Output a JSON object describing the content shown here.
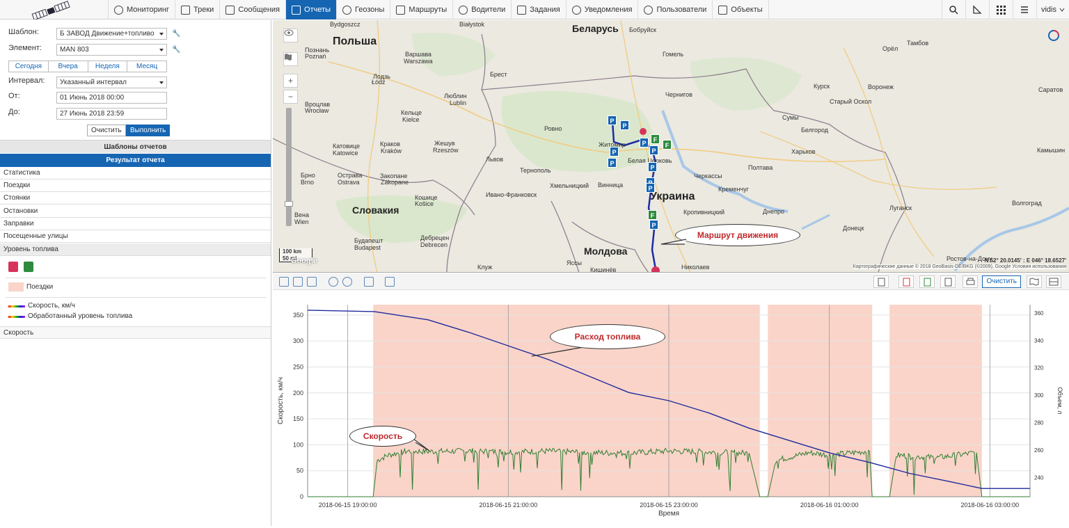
{
  "nav": {
    "items": [
      {
        "label": "Мониторинг",
        "icon": "globe-icon"
      },
      {
        "label": "Треки",
        "icon": "track-icon"
      },
      {
        "label": "Сообщения",
        "icon": "messages-icon"
      },
      {
        "label": "Отчеты",
        "icon": "reports-icon",
        "active": true
      },
      {
        "label": "Геозоны",
        "icon": "geofence-icon"
      },
      {
        "label": "Маршруты",
        "icon": "routes-icon"
      },
      {
        "label": "Водители",
        "icon": "driver-icon"
      },
      {
        "label": "Задания",
        "icon": "tasks-icon"
      },
      {
        "label": "Уведомления",
        "icon": "notifications-icon"
      },
      {
        "label": "Пользователи",
        "icon": "users-icon"
      },
      {
        "label": "Объекты",
        "icon": "truck-icon"
      }
    ],
    "user": "vidis"
  },
  "form": {
    "template_label": "Шаблон:",
    "template_value": "Б    ЗАВОД Движение+топливо",
    "element_label": "Элемент:",
    "element_value": "MAN 803",
    "quick": [
      "Сегодня",
      "Вчера",
      "Неделя",
      "Месяц"
    ],
    "interval_label": "Интервал:",
    "interval_value": "Указанный интервал",
    "from_label": "От:",
    "from_value": "01 Июнь 2018 00:00",
    "to_label": "До:",
    "to_value": "27 Июнь 2018 23:59",
    "clear": "Очистить",
    "run": "Выполнить"
  },
  "panels": {
    "templates_header": "Шаблоны отчетов",
    "result_header": "Результат отчета",
    "items": [
      "Статистика",
      "Поездки",
      "Стоянки",
      "Остановки",
      "Заправки",
      "Посещенные улицы",
      "Уровень топлива"
    ],
    "legend_trips": "Поездки",
    "legend_speed": "Скорость, км/ч",
    "legend_fuel": "Обработанный уровень топлива",
    "speed_item": "Скорость"
  },
  "map": {
    "countries": [
      {
        "label": "Польша"
      },
      {
        "label": "Беларусь"
      },
      {
        "label": "Украина"
      },
      {
        "label": "Словакия"
      },
      {
        "label": "Молдова"
      }
    ],
    "cities": [
      "Bydgoszcz",
      "Białystok",
      "Бобруйск",
      "Тамбов",
      "Познань",
      "Poznań",
      "Варшава",
      "Warszawa",
      "Гомель",
      "Орёл",
      "Брест",
      "Лодзь",
      "Łódź",
      "Люблин",
      "Lublin",
      "Чернигов",
      "Курск",
      "Воронеж",
      "Саратов",
      "Вроцлав",
      "Wrocław",
      "Кельце",
      "Kielce",
      "Ровно",
      "Житомир",
      "Сумы",
      "Старый Оскол",
      "Белгород",
      "Катовице",
      "Katowice",
      "Краков",
      "Kraków",
      "Жешув",
      "Rzeszów",
      "Львов",
      "Тернополь",
      "Белая Церковь",
      "Полтава",
      "Харьков",
      "Брно",
      "Brno",
      "Острава",
      "Ostrava",
      "Закопане",
      "Zakopane",
      "Хмельницкий",
      "Винница",
      "Черкассы",
      "Кременчуг",
      "Камышин",
      "Ивано-Франковск",
      "Кропивницкий",
      "Днепро",
      "Луганск",
      "Волгоград",
      "Вена",
      "Wien",
      "Кошице",
      "Košice",
      "Донецк",
      "Ростов-на-Дону",
      "Будапешт",
      "Budapest",
      "Дебрецен",
      "Debrecen",
      "Клуж",
      "Яссы",
      "Николаев",
      "Кишинёв"
    ],
    "route_callout": "Маршрут движения",
    "scale_km": "100 km",
    "scale_mi": "50 mi",
    "coords": "N 52° 20.0145' : E 046° 18.6527'",
    "attribution": "Картографические данные © 2018 GeoBasis-DE/BKG (©2009), Google   Условия использования",
    "google": "Google"
  },
  "chart_toolbar": {
    "clear": "Очистить"
  },
  "chart_data": {
    "type": "line",
    "title": "",
    "xlabel": "Время",
    "ylabel": "Скорость, км/ч",
    "y2label": "Объем, л",
    "ylim": [
      0,
      370
    ],
    "y2lim": [
      226,
      366
    ],
    "yticks": [
      0,
      50,
      100,
      150,
      200,
      250,
      300,
      350
    ],
    "y2ticks": [
      240,
      260,
      280,
      300,
      320,
      340,
      360
    ],
    "xlim": [
      "2018-06-15 18:30",
      "2018-06-16 03:30"
    ],
    "xticks": [
      "2018-06-15 19:00:00",
      "2018-06-15 21:00:00",
      "2018-06-15 23:00:00",
      "2018-06-16 01:00:00",
      "2018-06-16 03:00:00"
    ],
    "trips": [
      {
        "start": "2018-06-15 19:19",
        "end": "2018-06-16 00:08"
      },
      {
        "start": "2018-06-16 00:14",
        "end": "2018-06-16 01:32"
      },
      {
        "start": "2018-06-16 01:45",
        "end": "2018-06-16 02:54"
      }
    ],
    "series": [
      {
        "name": "Скорость, км/ч",
        "color": "#2e7d32",
        "x": [
          "18:30",
          "19:19",
          "19:22",
          "19:30",
          "19:45",
          "20:00",
          "20:30",
          "21:00",
          "21:30",
          "22:00",
          "22:30",
          "23:00",
          "23:30",
          "00:00",
          "00:08",
          "00:14",
          "00:20",
          "00:45",
          "01:00",
          "01:30",
          "01:32",
          "01:45",
          "01:50",
          "02:20",
          "02:50",
          "02:54",
          "03:30"
        ],
        "values": [
          0,
          0,
          70,
          80,
          88,
          87,
          88,
          86,
          88,
          85,
          84,
          88,
          86,
          84,
          0,
          0,
          70,
          85,
          80,
          88,
          0,
          0,
          80,
          75,
          85,
          0,
          0
        ]
      },
      {
        "name": "Обработанный уровень топлива",
        "color": "#1f2a9c",
        "x": [
          "18:30",
          "19:20",
          "20:00",
          "20:30",
          "21:00",
          "21:30",
          "22:00",
          "22:30",
          "23:00",
          "23:30",
          "00:00",
          "00:30",
          "01:00",
          "01:30",
          "02:00",
          "02:30",
          "02:54",
          "03:30"
        ],
        "values": [
          362,
          361,
          355,
          346,
          336,
          326,
          314,
          302,
          296,
          287,
          276,
          267,
          258,
          251,
          243,
          237,
          232,
          232
        ]
      }
    ],
    "annotations": [
      "Расход топлива",
      "Скорость"
    ],
    "grid": true
  },
  "colors": {
    "accent": "#1565b3",
    "trip_fill": "#fad4c9",
    "speed": "#2e7d32",
    "fuel": "#1f2a9c",
    "callout_text": "#c0282b"
  }
}
